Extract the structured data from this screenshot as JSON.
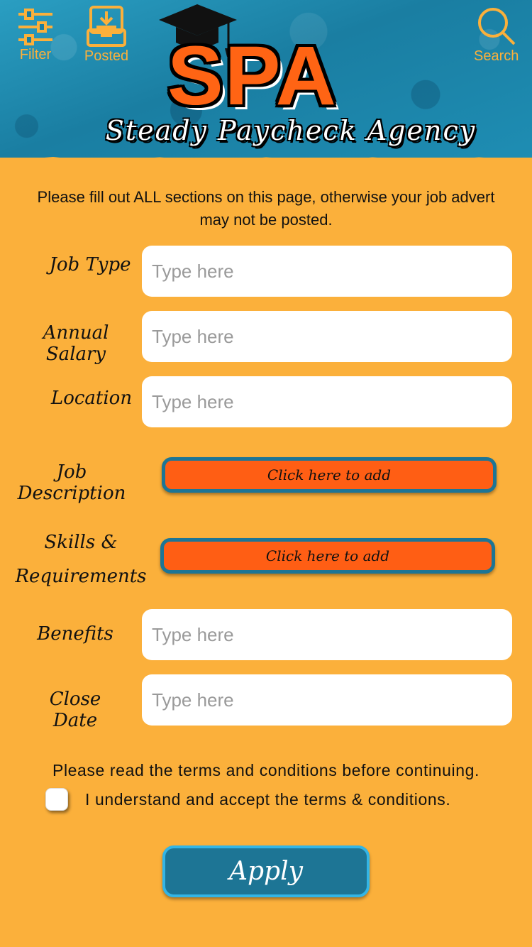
{
  "header": {
    "filter_label": "Filter",
    "posted_label": "Posted",
    "search_label": "Search",
    "logo_title": "SPA",
    "logo_subtitle": "Steady Paycheck Agency"
  },
  "form": {
    "instructions": "Please fill out ALL sections on this page, otherwise your job advert may not be posted.",
    "job_type": {
      "label": "Job Type",
      "placeholder": "Type here"
    },
    "annual_salary": {
      "label": "Annual Salary",
      "placeholder": "Type here"
    },
    "location": {
      "label": "Location",
      "placeholder": "Type here"
    },
    "job_description": {
      "label": "Job Description",
      "button": "Click here to add"
    },
    "skills": {
      "label_line1": "Skills &",
      "label_line2": "Requirements",
      "button": "Click here to add"
    },
    "benefits": {
      "label": "Benefits",
      "placeholder": "Type here"
    },
    "close_date": {
      "label": "Close Date",
      "placeholder": "Type here"
    },
    "terms_note": "Please read the terms and conditions before continuing.",
    "terms_checkbox_label": "I understand and accept the terms & conditions.",
    "terms_checked": false,
    "apply_label": "Apply"
  },
  "colors": {
    "background": "#fbb03b",
    "header": "#1a7ea2",
    "accent_orange": "#ff5e14",
    "button_blue": "#1d7595"
  },
  "icons": [
    "sliders-icon",
    "inbox-download-icon",
    "search-icon",
    "graduation-cap-icon"
  ]
}
